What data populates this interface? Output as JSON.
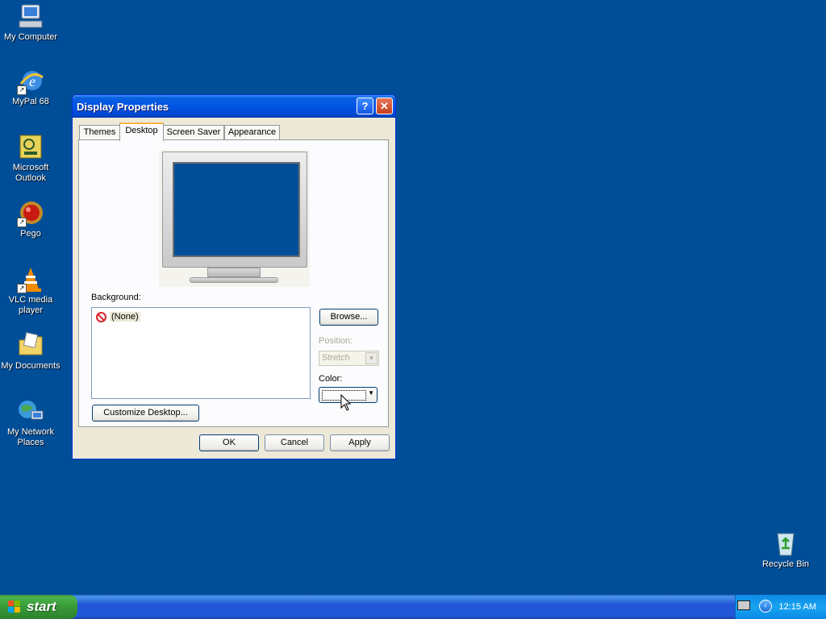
{
  "desktop": {
    "icons": [
      {
        "label": "My Computer"
      },
      {
        "label": "MyPal 68"
      },
      {
        "label": "Microsoft Outlook"
      },
      {
        "label": "Pego"
      },
      {
        "label": "VLC media player"
      },
      {
        "label": "My Documents"
      },
      {
        "label": "My Network Places"
      },
      {
        "label": "Recycle Bin"
      }
    ]
  },
  "window": {
    "title": "Display Properties",
    "help_label": "?",
    "close_label": "✕",
    "tabs": [
      {
        "label": "Themes"
      },
      {
        "label": "Desktop",
        "active": true
      },
      {
        "label": "Screen Saver"
      },
      {
        "label": "Appearance"
      }
    ],
    "background_label": "Background:",
    "background_items": [
      {
        "label": "(None)"
      }
    ],
    "browse_label": "Browse...",
    "position_label": "Position:",
    "position_value": "Stretch",
    "color_label": "Color:",
    "customize_label": "Customize Desktop...",
    "ok_label": "OK",
    "cancel_label": "Cancel",
    "apply_label": "Apply"
  },
  "taskbar": {
    "start_label": "start",
    "clock": "12:15 AM"
  },
  "colors": {
    "desktop_bg": "#004e98",
    "title_bar": "#0055e5",
    "window_bg": "#ece9d8"
  }
}
